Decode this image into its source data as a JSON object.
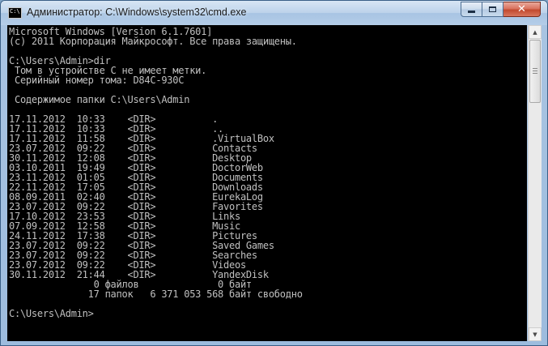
{
  "window": {
    "title": "Администратор: C:\\Windows\\system32\\cmd.exe",
    "icon_label": "C:\\",
    "buttons": {
      "minimize": "minimize-icon",
      "maximize": "maximize-icon",
      "close": "✕"
    }
  },
  "console": {
    "lines": [
      "Microsoft Windows [Version 6.1.7601]",
      "(c) 2011 Корпорация Майкрософт. Все права защищены.",
      "",
      "C:\\Users\\Admin>dir",
      " Том в устройстве C не имеет метки.",
      " Серийный номер тома: D84C-930C",
      "",
      " Содержимое папки C:\\Users\\Admin",
      "",
      "17.11.2012  10:33    <DIR>          .",
      "17.11.2012  10:33    <DIR>          ..",
      "17.11.2012  11:58    <DIR>          .VirtualBox",
      "23.07.2012  09:22    <DIR>          Contacts",
      "30.11.2012  12:08    <DIR>          Desktop",
      "03.10.2011  19:49    <DIR>          DoctorWeb",
      "23.11.2012  01:05    <DIR>          Documents",
      "22.11.2012  17:05    <DIR>          Downloads",
      "08.09.2011  02:40    <DIR>          EurekaLog",
      "23.07.2012  09:22    <DIR>          Favorites",
      "17.10.2012  23:53    <DIR>          Links",
      "07.09.2012  12:58    <DIR>          Music",
      "24.11.2012  17:38    <DIR>          Pictures",
      "23.07.2012  09:22    <DIR>          Saved Games",
      "23.07.2012  09:22    <DIR>          Searches",
      "23.07.2012  09:22    <DIR>          Videos",
      "30.11.2012  21:44    <DIR>          YandexDisk",
      "               0 файлов              0 байт",
      "              17 папок   6 371 053 568 байт свободно",
      "",
      "C:\\Users\\Admin>"
    ]
  },
  "scrollbar": {
    "up": "▲",
    "down": "▼"
  }
}
